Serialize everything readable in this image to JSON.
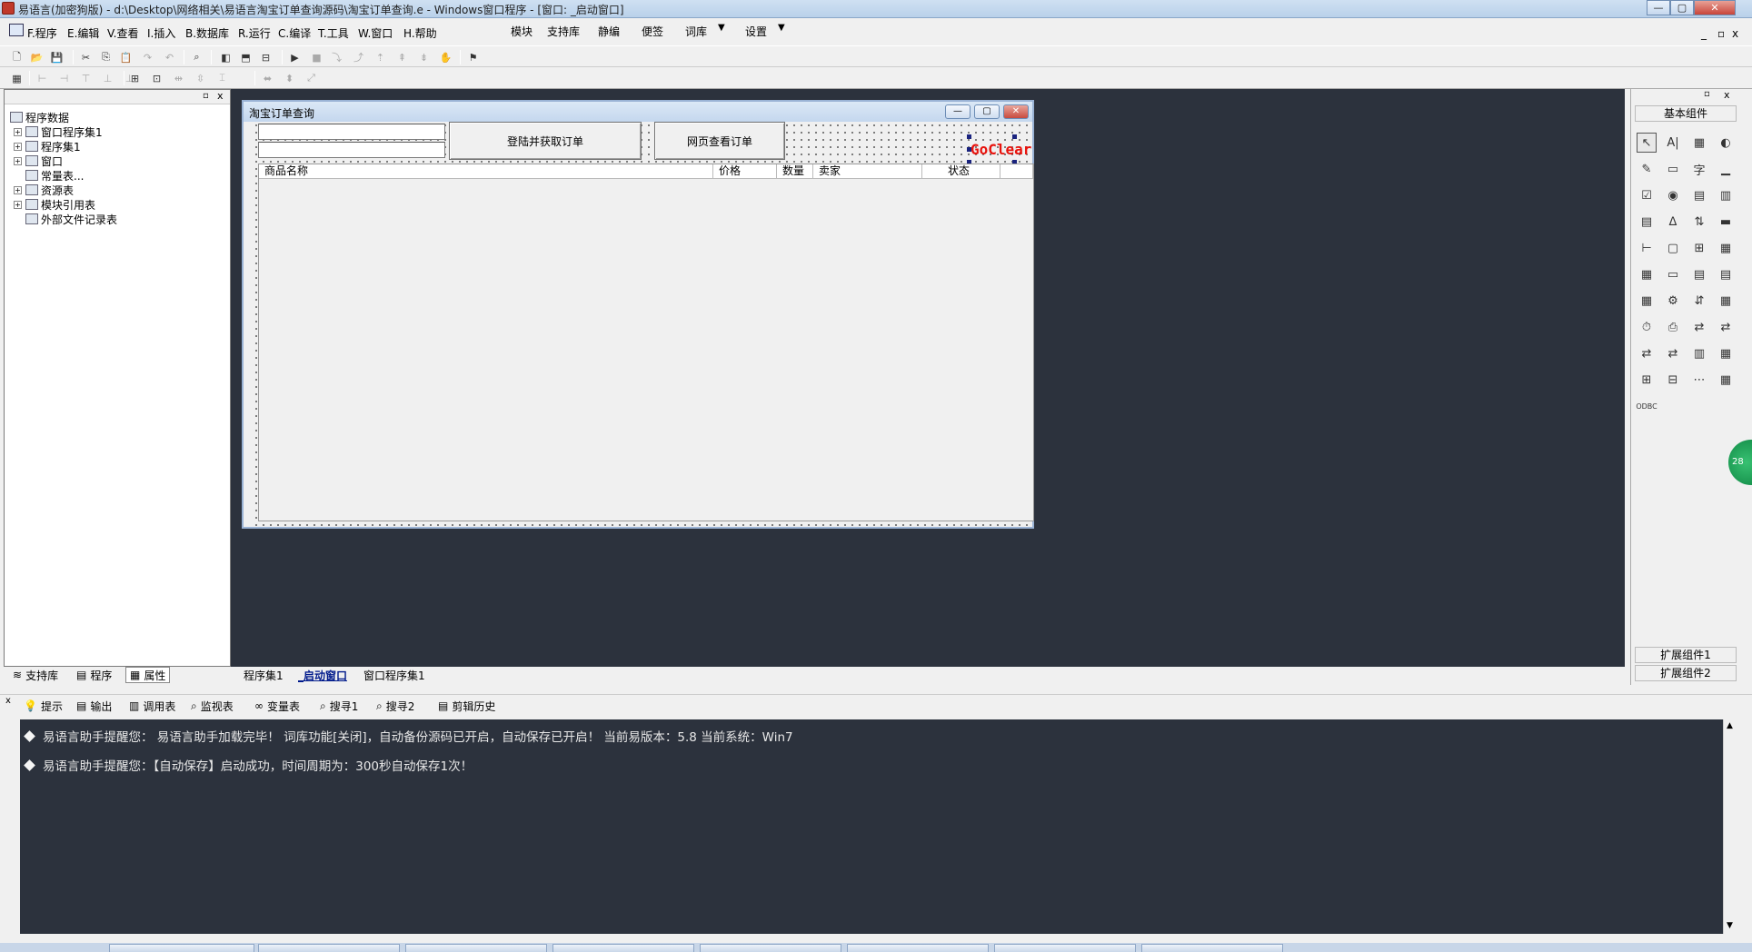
{
  "window": {
    "title": "易语言(加密狗版) - d:\\Desktop\\网络相关\\易语言淘宝订单查询源码\\淘宝订单查询.e - Windows窗口程序 - [窗口: _启动窗口]",
    "controls": [
      "—",
      "▢",
      "✕"
    ]
  },
  "menubar": {
    "items": [
      "F.程序",
      "E.编辑",
      "V.查看",
      "I.插入",
      "B.数据库",
      "R.运行",
      "C.编译",
      "T.工具",
      "W.窗口",
      "H.帮助"
    ],
    "extras": [
      "模块",
      "支持库",
      "静编",
      "便签",
      "词库",
      "设置"
    ],
    "mdi_controls": [
      "_",
      "▫",
      "x"
    ]
  },
  "toolbar1": {
    "buttons": [
      "new-file",
      "open-file",
      "save",
      "cut",
      "copy",
      "paste",
      "redo",
      "undo",
      "find",
      "layout-1",
      "layout-2",
      "layout-3",
      "run",
      "stop",
      "step-1",
      "step-2",
      "step-3",
      "step-4",
      "step-5",
      "step-6",
      "hand",
      "exec"
    ]
  },
  "toolbar2": {
    "buttons": [
      "align-grid",
      "align-left",
      "align-center",
      "align-top",
      "align-middle",
      "align-bottom",
      "group-1",
      "group-2",
      "spacing-1",
      "spacing-2",
      "size-1",
      "size-2",
      "size-3"
    ]
  },
  "left_panel": {
    "tree": [
      {
        "label": "程序数据",
        "level": 0,
        "expander": ""
      },
      {
        "label": "窗口程序集1",
        "level": 1,
        "expander": "+"
      },
      {
        "label": "程序集1",
        "level": 1,
        "expander": "+"
      },
      {
        "label": "窗口",
        "level": 1,
        "expander": "+"
      },
      {
        "label": "常量表...",
        "level": 1,
        "expander": ""
      },
      {
        "label": "资源表",
        "level": 1,
        "expander": "+"
      },
      {
        "label": "模块引用表",
        "level": 1,
        "expander": "+"
      },
      {
        "label": "外部文件记录表",
        "level": 1,
        "expander": ""
      }
    ],
    "tabs": [
      "支持库",
      "程序",
      "属性"
    ],
    "head_controls": [
      "▫",
      "x"
    ]
  },
  "form": {
    "title": "淘宝订单查询",
    "button_login": "登陆并获取订单",
    "button_web": "网页查看订单",
    "label_logo": "GoClear",
    "columns": [
      "商品名称",
      "价格",
      "数量",
      "卖家",
      "状态"
    ],
    "window_buttons": [
      "—",
      "▢",
      "✕"
    ]
  },
  "designer_tabs": [
    "程序集1",
    "_启动窗口",
    "窗口程序集1"
  ],
  "right_panel": {
    "header": "基本组件",
    "footer_1": "扩展组件1",
    "footer_2": "扩展组件2",
    "components": [
      "↖",
      "A|",
      "▦",
      "◐",
      "✎",
      "▭",
      "字",
      "▁",
      "☑",
      "◉",
      "▤",
      "▥",
      "▤",
      "ᐃ",
      "⇅",
      "▬",
      "⊢",
      "▢",
      "⊞",
      "▦",
      "▦",
      "▭",
      "▤",
      "▤",
      "▦",
      "⚙",
      "⇵",
      "▦",
      "⏱",
      "⎙",
      "⇄",
      "⇄",
      "⇄",
      "⇄",
      "▥",
      "▦",
      "⊞",
      "⊟",
      "⋯",
      "▦",
      "ODBC"
    ],
    "head_controls": [
      "▫",
      "x"
    ]
  },
  "bottom_tabs": [
    "提示",
    "输出",
    "调用表",
    "监视表",
    "变量表",
    "搜寻1",
    "搜寻2",
    "剪辑历史"
  ],
  "output": {
    "lines": [
      "易语言助手提醒您：  易语言助手加载完毕！ 词库功能[关闭]，自动备份源码已开启，自动保存已开启！ 当前易版本：5.8  当前系统：Win7",
      "易语言助手提醒您：【自动保存】启动成功，时间周期为：300秒自动保存1次！"
    ]
  },
  "side_badge": "28",
  "colors": {
    "designer_bg": "#2c323d",
    "logo_red": "#e8120c",
    "title_bar": "#c4d7ee"
  }
}
